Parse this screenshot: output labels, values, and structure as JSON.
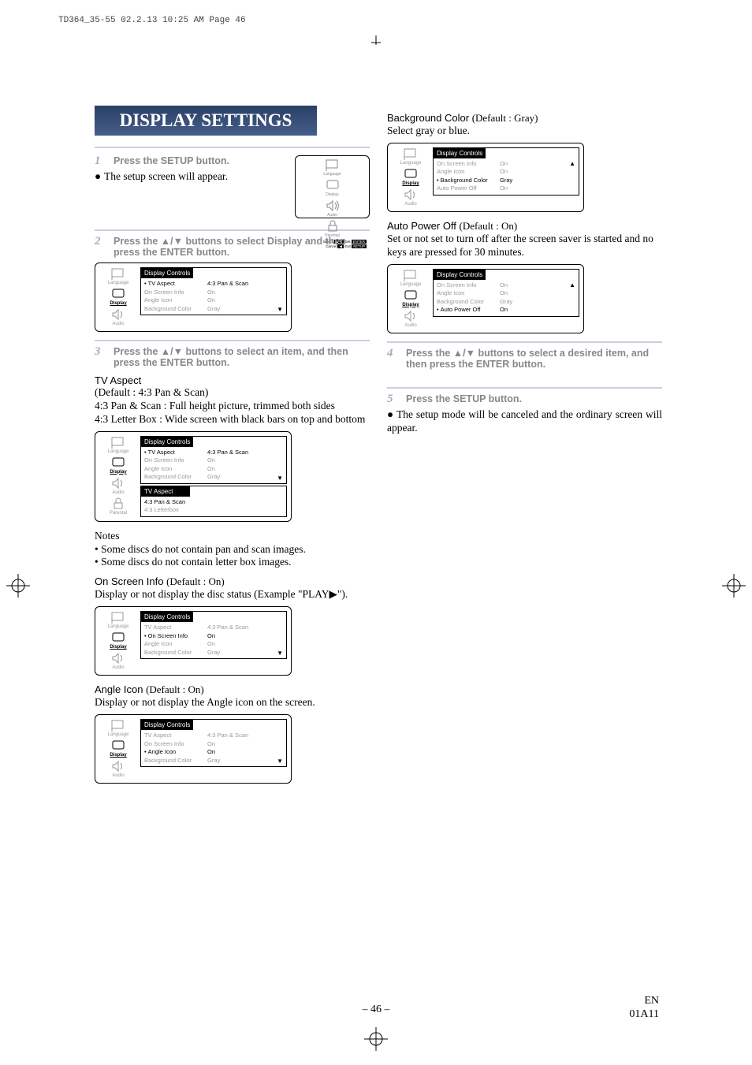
{
  "header_spool": "TD364_35-55  02.2.13  10:25 AM  Page 46",
  "section_title": "DISPLAY SETTINGS",
  "steps": {
    "s1": "Press the SETUP button.",
    "s1_body": "The setup screen will appear.",
    "s2": "Press the ▲/▼ buttons to select Display and then press the ENTER button.",
    "s3": "Press the ▲/▼ buttons to select an item, and then press the ENTER button.",
    "s4": "Press the ▲/▼ buttons to select a desired item, and then press the ENTER button.",
    "s5": "Press the SETUP button.",
    "s5_body": "The setup mode will be canceled and the ordinary screen will appear."
  },
  "tv_aspect": {
    "title": "TV Aspect",
    "default": "(Default : 4:3 Pan & Scan)",
    "line1": "4:3 Pan & Scan : Full height picture, trimmed both sides",
    "line2": "4:3 Letter Box : Wide screen with black bars on top and bottom",
    "notes_label": "Notes",
    "note1": "• Some discs do not contain pan and scan images.",
    "note2": "• Some discs do not contain letter box images."
  },
  "on_screen": {
    "title": "On Screen Info",
    "default": "(Default : On)",
    "desc": "Display or not display the disc status (Example \"PLAY▶\")."
  },
  "angle": {
    "title": "Angle Icon",
    "default": "(Default : On)",
    "desc": "Display or not display the Angle icon on the screen."
  },
  "bg": {
    "title": "Background Color",
    "default": "(Default : Gray)",
    "desc": "Select gray or blue."
  },
  "auto": {
    "title": "Auto Power Off",
    "default": "(Default : On)",
    "desc": "Set or not set to turn off after the screen saver is started and no keys are pressed for 30 minutes."
  },
  "osd": {
    "title": "Display Controls",
    "rows": [
      {
        "lbl": "TV Aspect",
        "val": "4:3 Pan & Scan"
      },
      {
        "lbl": "On Screen Info",
        "val": "On"
      },
      {
        "lbl": "Angle Icon",
        "val": "On"
      },
      {
        "lbl": "Background Color",
        "val": "Gray"
      },
      {
        "lbl": "Auto Power Off",
        "val": "On"
      }
    ],
    "sidebar": [
      "Language",
      "Display",
      "Audio",
      "Parental"
    ],
    "submenu_title": "TV Aspect",
    "submenu_items": [
      "4:3 Pan & Scan",
      "4:3 Letterbox"
    ],
    "mini_footer": {
      "l1a": "Select",
      "l1b": "Set",
      "l1k1": "▲▼",
      "l1k2": "ENTER",
      "l2a": "Cancel",
      "l2b": "Exit",
      "l2k1": "◀",
      "l2k2": "SETUP"
    }
  },
  "page_number": "– 46 –",
  "page_code_1": "EN",
  "page_code_2": "01A11"
}
